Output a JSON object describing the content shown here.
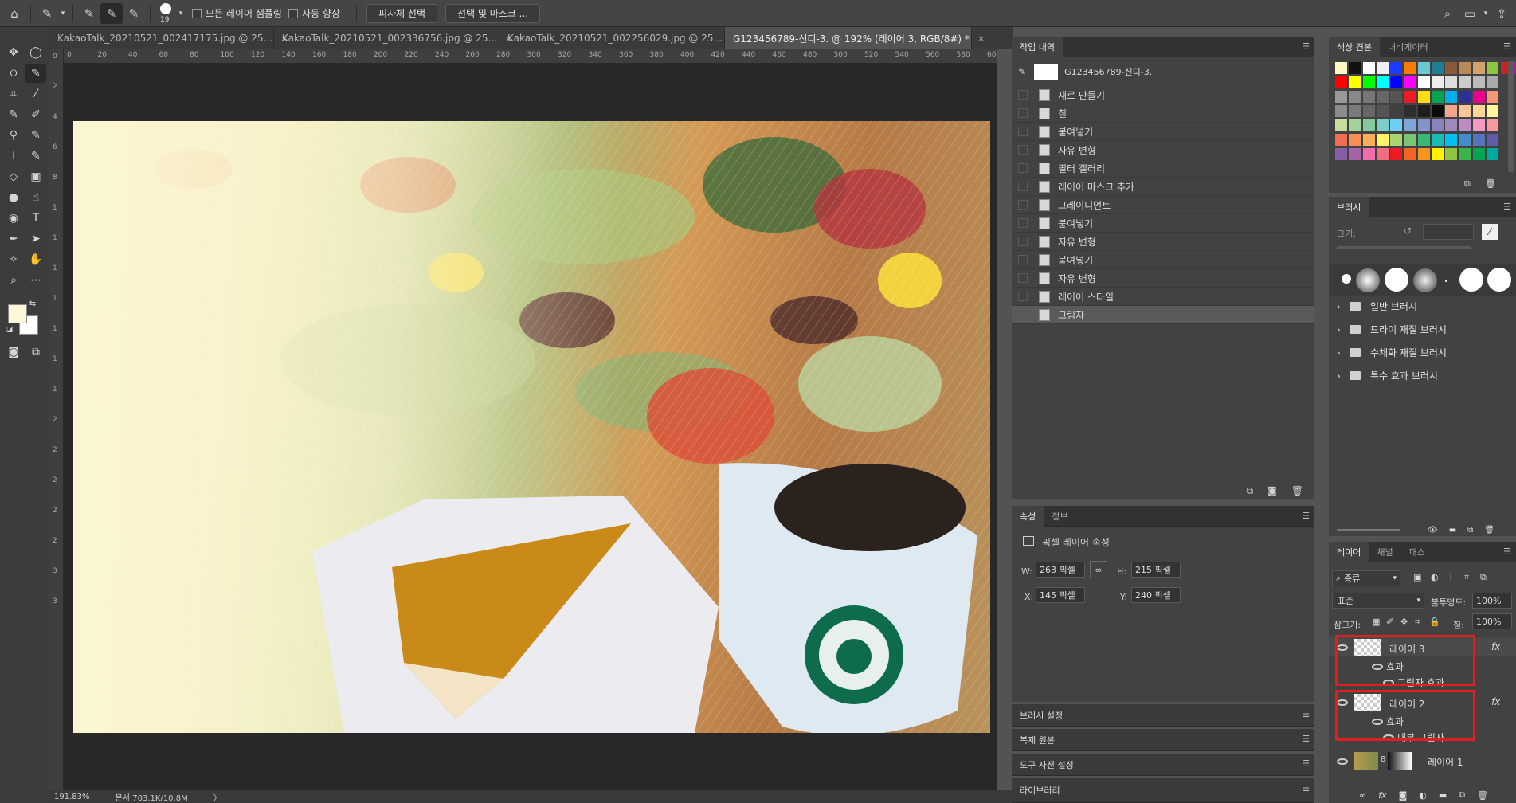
{
  "options_bar": {
    "brush_size": "19",
    "sample_all_layers_label": "모든 레이어 샘플링",
    "auto_enhance_label": "자동 향상",
    "select_subject_label": "피사체 선택",
    "select_and_mask_label": "선택 및 마스크 ..."
  },
  "tabs": [
    {
      "label": "KakaoTalk_20210521_002417175.jpg @ 25...",
      "close": "×"
    },
    {
      "label": "KakaoTalk_20210521_002336756.jpg @ 25...",
      "close": "×"
    },
    {
      "label": "KakaoTalk_20210521_002256029.jpg @ 25...",
      "close": "×"
    },
    {
      "label": "G123456789-신디-3. @ 192% (레이어 3, RGB/8#) *",
      "close": "×"
    }
  ],
  "ruler_h": [
    "0",
    "20",
    "40",
    "60",
    "80",
    "100",
    "120",
    "140",
    "160",
    "180",
    "200",
    "220",
    "240",
    "260",
    "280",
    "300",
    "320",
    "340",
    "360",
    "380",
    "400",
    "420",
    "440",
    "460",
    "480",
    "500",
    "520",
    "540",
    "560",
    "580",
    "60"
  ],
  "ruler_v": [
    "0",
    "2",
    "4",
    "6",
    "8",
    "1",
    "1",
    "1",
    "1",
    "1",
    "1",
    "1",
    "2",
    "2",
    "2",
    "2",
    "2",
    "3",
    "3"
  ],
  "status": {
    "zoom": "191.83%",
    "doc": "문서:703.1K/10.8M",
    "arrow": "〉"
  },
  "history": {
    "tab": "작업 내역",
    "snapshot": "G123456789-신디-3.",
    "items": [
      "새로 만들기",
      "칠",
      "붙여넣기",
      "자유 변형",
      "필터 갤러리",
      "레이어 마스크 추가",
      "그레이디언트",
      "붙여넣기",
      "자유 변형",
      "붙여넣기",
      "자유 변형",
      "레이어 스타일",
      "그림자"
    ]
  },
  "properties": {
    "tab": "속성",
    "tab2": "정보",
    "title": "픽셀 레이어 속성",
    "w_label": "W:",
    "w": "263 픽셀",
    "h_label": "H:",
    "h": "215 픽셀",
    "x_label": "X:",
    "x": "145 픽셀",
    "y_label": "Y:",
    "y": "240 픽셀"
  },
  "collapsed": [
    "브러시 설정",
    "복제 원본",
    "도구 사전 설정",
    "라이브러리"
  ],
  "swatches_tabs": {
    "tab": "색상 견본",
    "tab2": "내비게이터"
  },
  "brush": {
    "tab": "브러시",
    "size_label": "크기:",
    "folders": [
      "일반 브러시",
      "드라이 재질 브러시",
      "수채화 재질 브러시",
      "특수 효과 브러시"
    ]
  },
  "layers": {
    "tab": "레이어",
    "tab2": "채널",
    "tab3": "패스",
    "filter": "종류",
    "blend": "표준",
    "opacity_label": "불투명도:",
    "opacity": "100%",
    "lock_label": "잠그기:",
    "fill_label": "칠:",
    "fill": "100%",
    "fx": "fx",
    "items": [
      {
        "name": "레이어 3",
        "effects_label": "효과",
        "effect": "그림자 효과"
      },
      {
        "name": "레이어 2",
        "effects_label": "효과",
        "effect": "내부 그림자"
      },
      {
        "name": "레이어 1"
      }
    ]
  },
  "colors": {
    "fg": "#fdf8d7",
    "bg": "#ffffff",
    "highlight": "#e02020"
  }
}
